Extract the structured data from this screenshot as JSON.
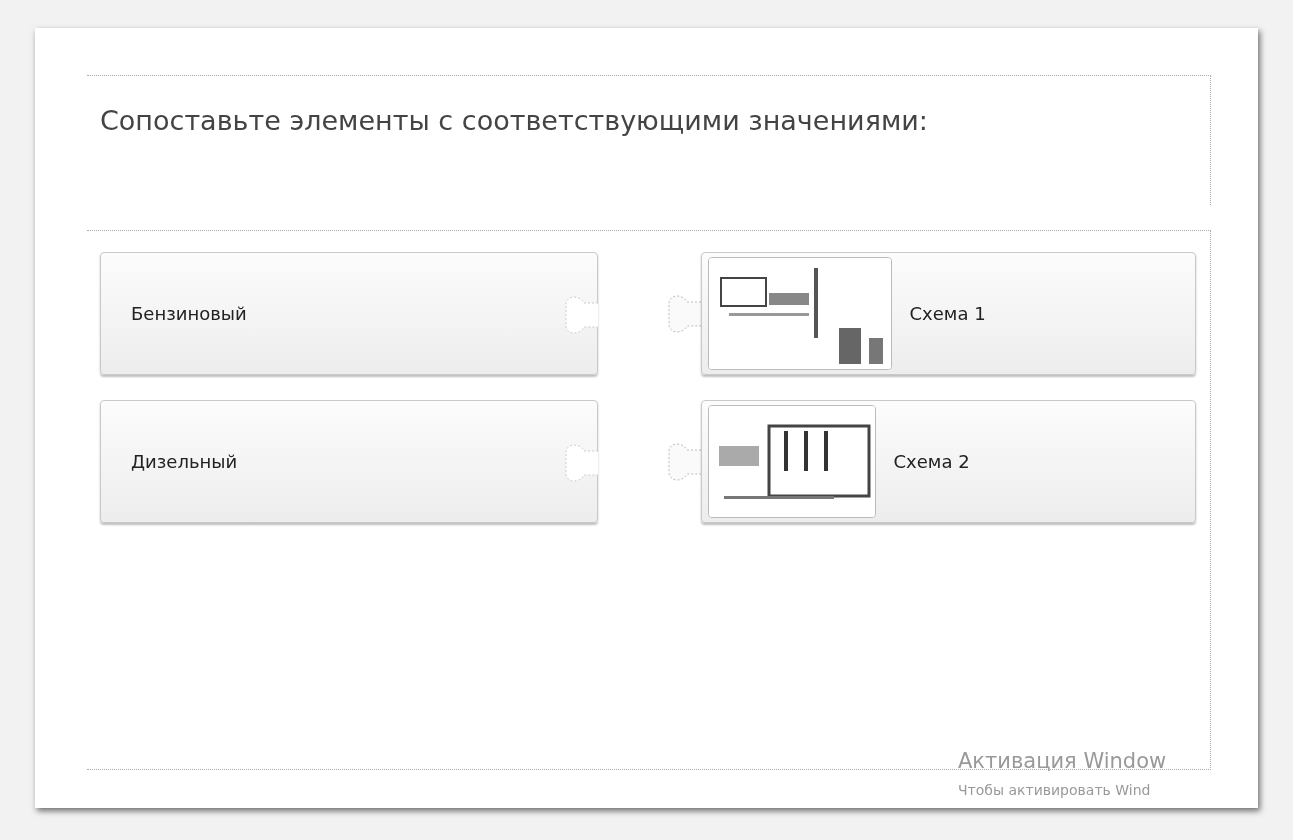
{
  "title": "Сопоставьте элементы с соответствующими значениями:",
  "items": [
    {
      "label": "Бензиновый"
    },
    {
      "label": "Дизельный"
    }
  ],
  "matches": [
    {
      "label": "Схема 1",
      "kind": "picture"
    },
    {
      "label": "Схема 2",
      "kind": "picture"
    }
  ],
  "os_notice": {
    "title": "Активация Window",
    "lines": [
      "Чтобы активировать Wind"
    ]
  }
}
